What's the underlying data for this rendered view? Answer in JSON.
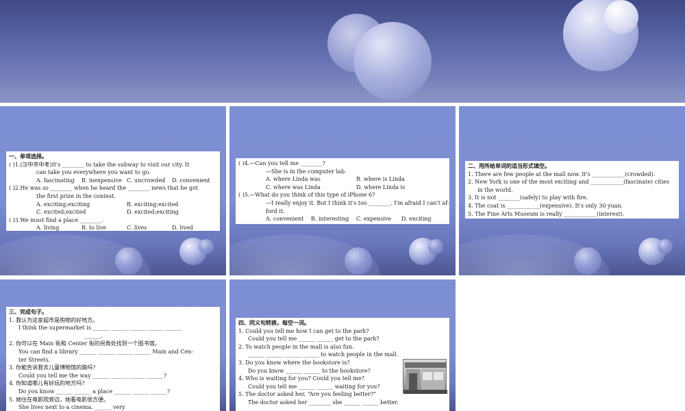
{
  "slide1": {
    "heading": "一、单项选择。",
    "q1": {
      "num": "(      )1.",
      "tag": "(汉中市中考)",
      "text": "It's ________ to take the subway to visit our city. It",
      "cont": "can take you everywhere you want to go.",
      "options": [
        "A. fascinating",
        "B. inexpensive",
        "C. uncrowded",
        "D. convenient"
      ]
    },
    "q2": {
      "num": "(      )2.",
      "text": "He was so ________ when he heard the ________ news that he got",
      "cont": "the first prize in the contest.",
      "options": [
        "A. exciting;exciting",
        "B. exciting;excited",
        "C. excited;excited",
        "D. excited;exciting"
      ]
    },
    "q3": {
      "num": "(      )3.",
      "text": "We must find a place ________.",
      "options": [
        "A. living",
        "B. to live",
        "C. lives",
        "D. lived"
      ]
    }
  },
  "slide2": {
    "q4": {
      "num": "(      )4.",
      "line1": "—Can you tell me ________?",
      "line2": "—She is in the computer lab.",
      "options": [
        "A. where Linda was",
        "B. where is Linda",
        "C. where was Linda",
        "D. where Linda is"
      ]
    },
    "q5": {
      "num": "(      )5.",
      "line1": "—What do you think of this type of iPhone 6?",
      "line2": "—I really enjoy it. But I think it's too ________. I'm afraid I can't af-",
      "line3": "ford it.",
      "options": [
        "A. convenient",
        "B. interesting",
        "C. expensive",
        "D. exciting"
      ]
    }
  },
  "slide3": {
    "heading": "二、用所给单词的适当形式填空。",
    "items": [
      "1. There are few people at the mall now. It's ____________(crowded).",
      "2. New York is one of the most exciting and ____________(fascinate) cities",
      "in the world.",
      "3. It is not ________(safely) to play with fire.",
      "4. The coat is ____________(expensive). It's only 30 yuan.",
      "5. The Fine Arts Museum is really ____________(interest)."
    ]
  },
  "slide4": {
    "heading": "三、完成句子。",
    "lines": [
      "1. 我认为这家超市是购物的好地方。",
      "I think the supermarket is ______ ______ ______ ______ ______",
      "______.",
      "2. 你可以在 Main 街和 Center 街的拐角处找到一个图书馆。",
      "You can find a library ______ ______ ______ ______ Main and Cen-",
      "ter Streets.",
      "3. 你能告诉我去儿童博物馆的路吗?",
      "Could you tell me the way ______ ______ ______ ______?",
      "4. 你知道哪儿有好玩的地方吗?",
      "Do you know ______ ______ a place ______ ______ ______?",
      "5. 她住在电影院旁边，她看电影很方便。",
      "She lives next to a cinema. ______ very"
    ]
  },
  "slide5": {
    "heading": "四、同义句转换，每空一词。",
    "lines": [
      "1. Could you tell me how I can get to the park?",
      "Could you tell me ______ ______ get to the park?",
      "2. To watch people in the mall is also fun.",
      "______ ______ ______ ______ to watch people in the mall.",
      "3. Do you know where the bookstore is?",
      "Do you know ______ ______ to the bookstore?",
      "4. Who is waiting for you? Could you tell me?",
      "Could you tell me ______ ______ waiting for you?",
      "5. The doctor asked her, “Are you feeling better?”",
      "The doctor asked her ________ she ______ ______ better."
    ]
  }
}
